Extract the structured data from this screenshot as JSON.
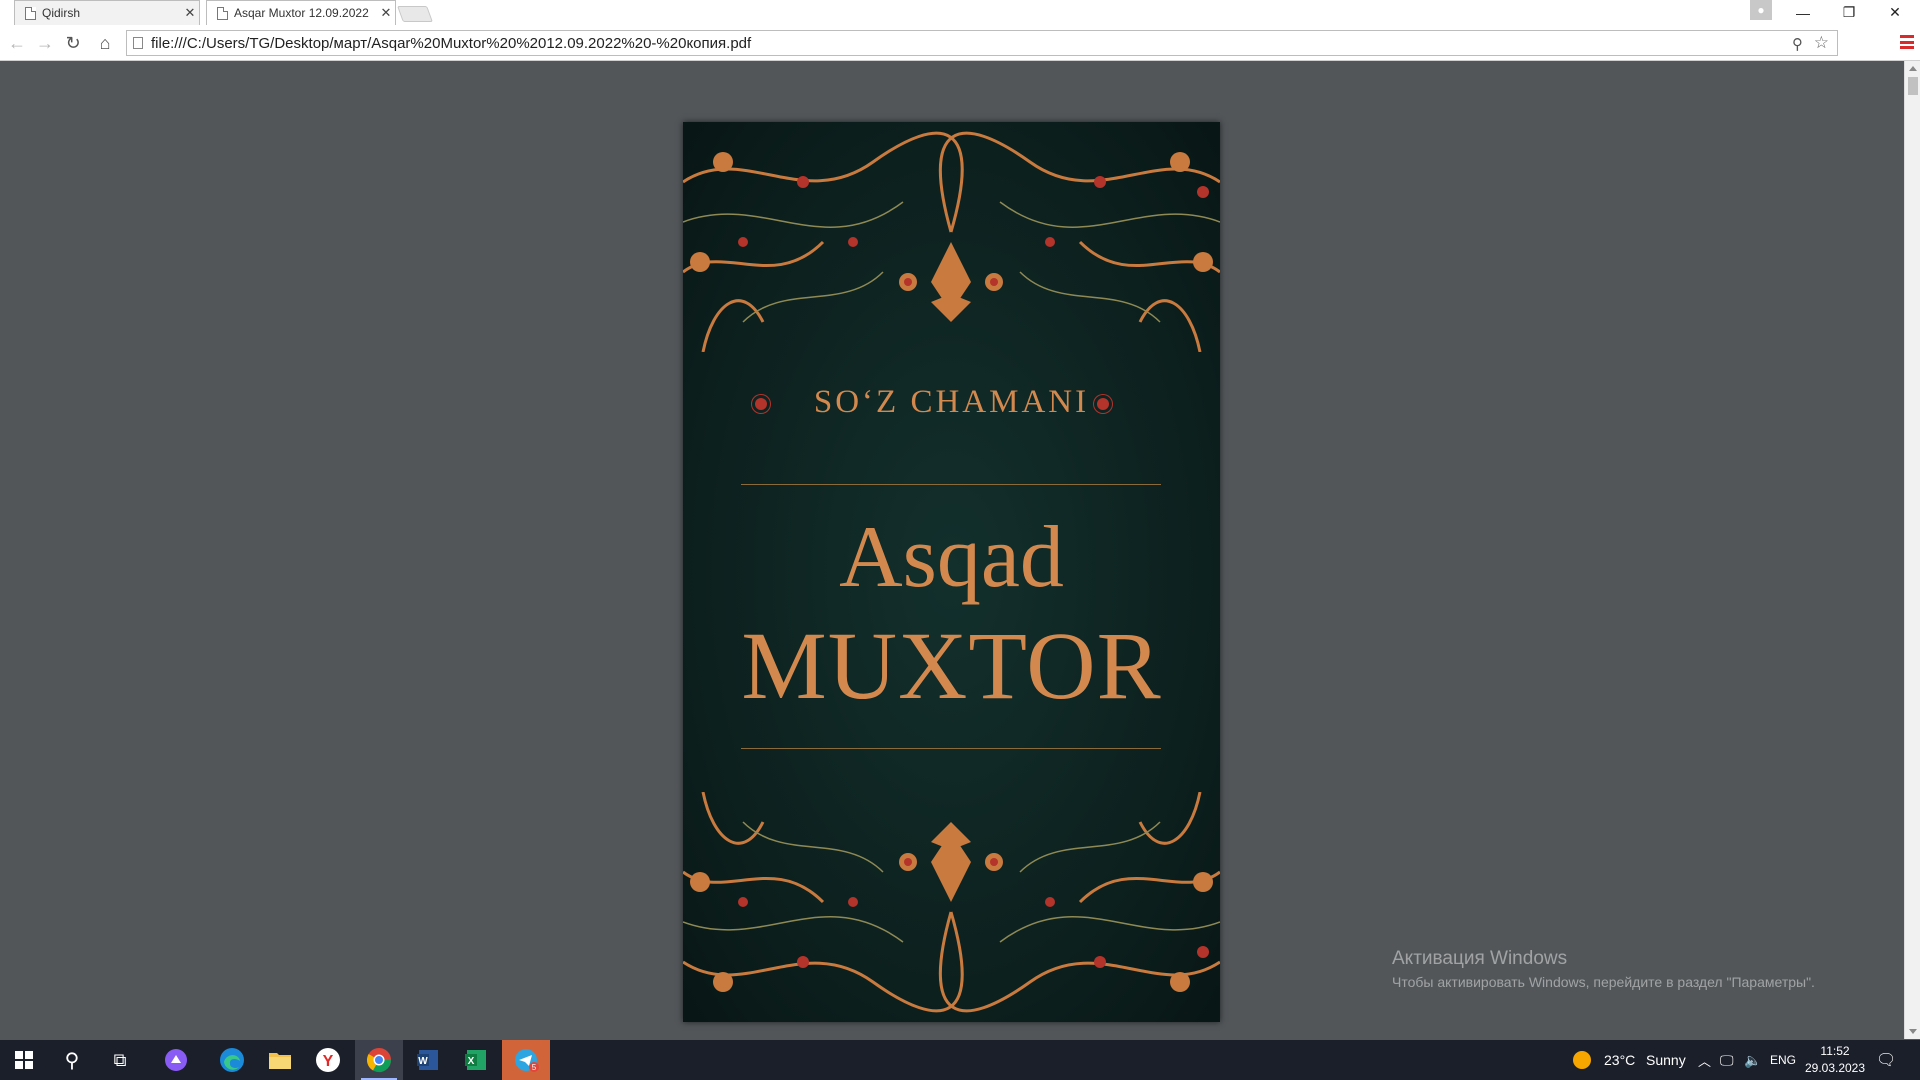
{
  "browser": {
    "tabs": [
      {
        "label": "Qidirsh",
        "active": false
      },
      {
        "label": "Asqar Muxtor  12.09.2022",
        "active": true
      }
    ],
    "url": "file:///C:/Users/TG/Desktop/март/Asqar%20Muxtor%20%2012.09.2022%20-%20копия.pdf"
  },
  "cover": {
    "series": "SO‘Z CHAMANI",
    "author_first": "Asqad",
    "author_last": "MUXTOR",
    "colors": {
      "background": "#0e2422",
      "accent": "#d3894e",
      "red": "#b4332a"
    }
  },
  "activation": {
    "title": "Активация Windows",
    "subtitle": "Чтобы активировать Windows, перейдите в раздел \"Параметры\"."
  },
  "taskbar": {
    "weather_temp": "23°C",
    "weather_text": "Sunny",
    "language": "ENG",
    "time": "11:52",
    "date": "29.03.2023",
    "telegram_badge": "5",
    "apps": [
      "windows-start",
      "search",
      "task-view",
      "alice",
      "edge",
      "file-explorer",
      "yandex-browser",
      "chrome",
      "word",
      "excel",
      "telegram"
    ]
  }
}
